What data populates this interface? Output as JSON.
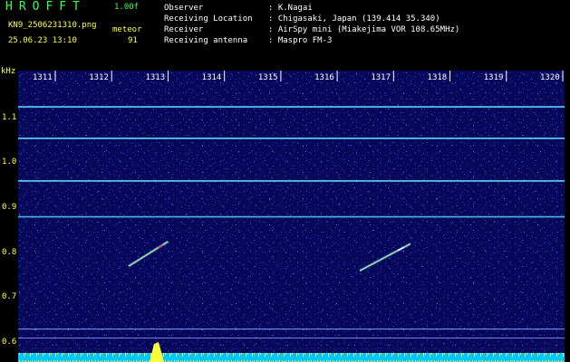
{
  "header": {
    "app_title": "HROFFT",
    "version": "1.00f",
    "filename": "KN9_2506231310.png",
    "mode_label": "meteor",
    "datetime": "25.06.23 13:10",
    "count": "91",
    "info": [
      {
        "label": "Observer",
        "value": ": K.Nagai"
      },
      {
        "label": "Receiving Location",
        "value": ": Chigasaki, Japan (139.414 35.340)"
      },
      {
        "label": "Receiver",
        "value": ": AirSpy mini (Miakejima VOR 108.65MHz)"
      },
      {
        "label": "Receiving antenna",
        "value": ": Maspro FM-3"
      }
    ]
  },
  "chart_data": {
    "type": "heatmap",
    "ylabel": "kHz",
    "y_ticks": [
      "1.1",
      "1.0",
      "0.9",
      "0.8",
      "0.7",
      "0.6"
    ],
    "x_ticks": [
      "1311",
      "1312",
      "1313",
      "1314",
      "1315",
      "1316",
      "1317",
      "1318",
      "1319",
      "1320"
    ],
    "ylim": [
      0.58,
      1.18
    ],
    "horizontal_lines_khz": [
      1.12,
      1.05,
      0.955,
      0.875,
      0.625
    ],
    "meteor_echoes": [
      {
        "t_start": "1312.3",
        "t_end": "1313.0",
        "f_start": 0.765,
        "f_end": 0.82
      },
      {
        "t_start": "1316.4",
        "t_end": "1317.3",
        "f_start": 0.755,
        "f_end": 0.815
      }
    ],
    "colors": {
      "background": "#08085a",
      "noise": "#2a3cd8",
      "line": "#5fe0ff",
      "echo": "#c8ff80",
      "echo_hot": "#ff5050",
      "bottom_bar": "#00c8ff",
      "bottom_peaks": "#ffff3c",
      "axis_text": "#ffff3c"
    }
  }
}
